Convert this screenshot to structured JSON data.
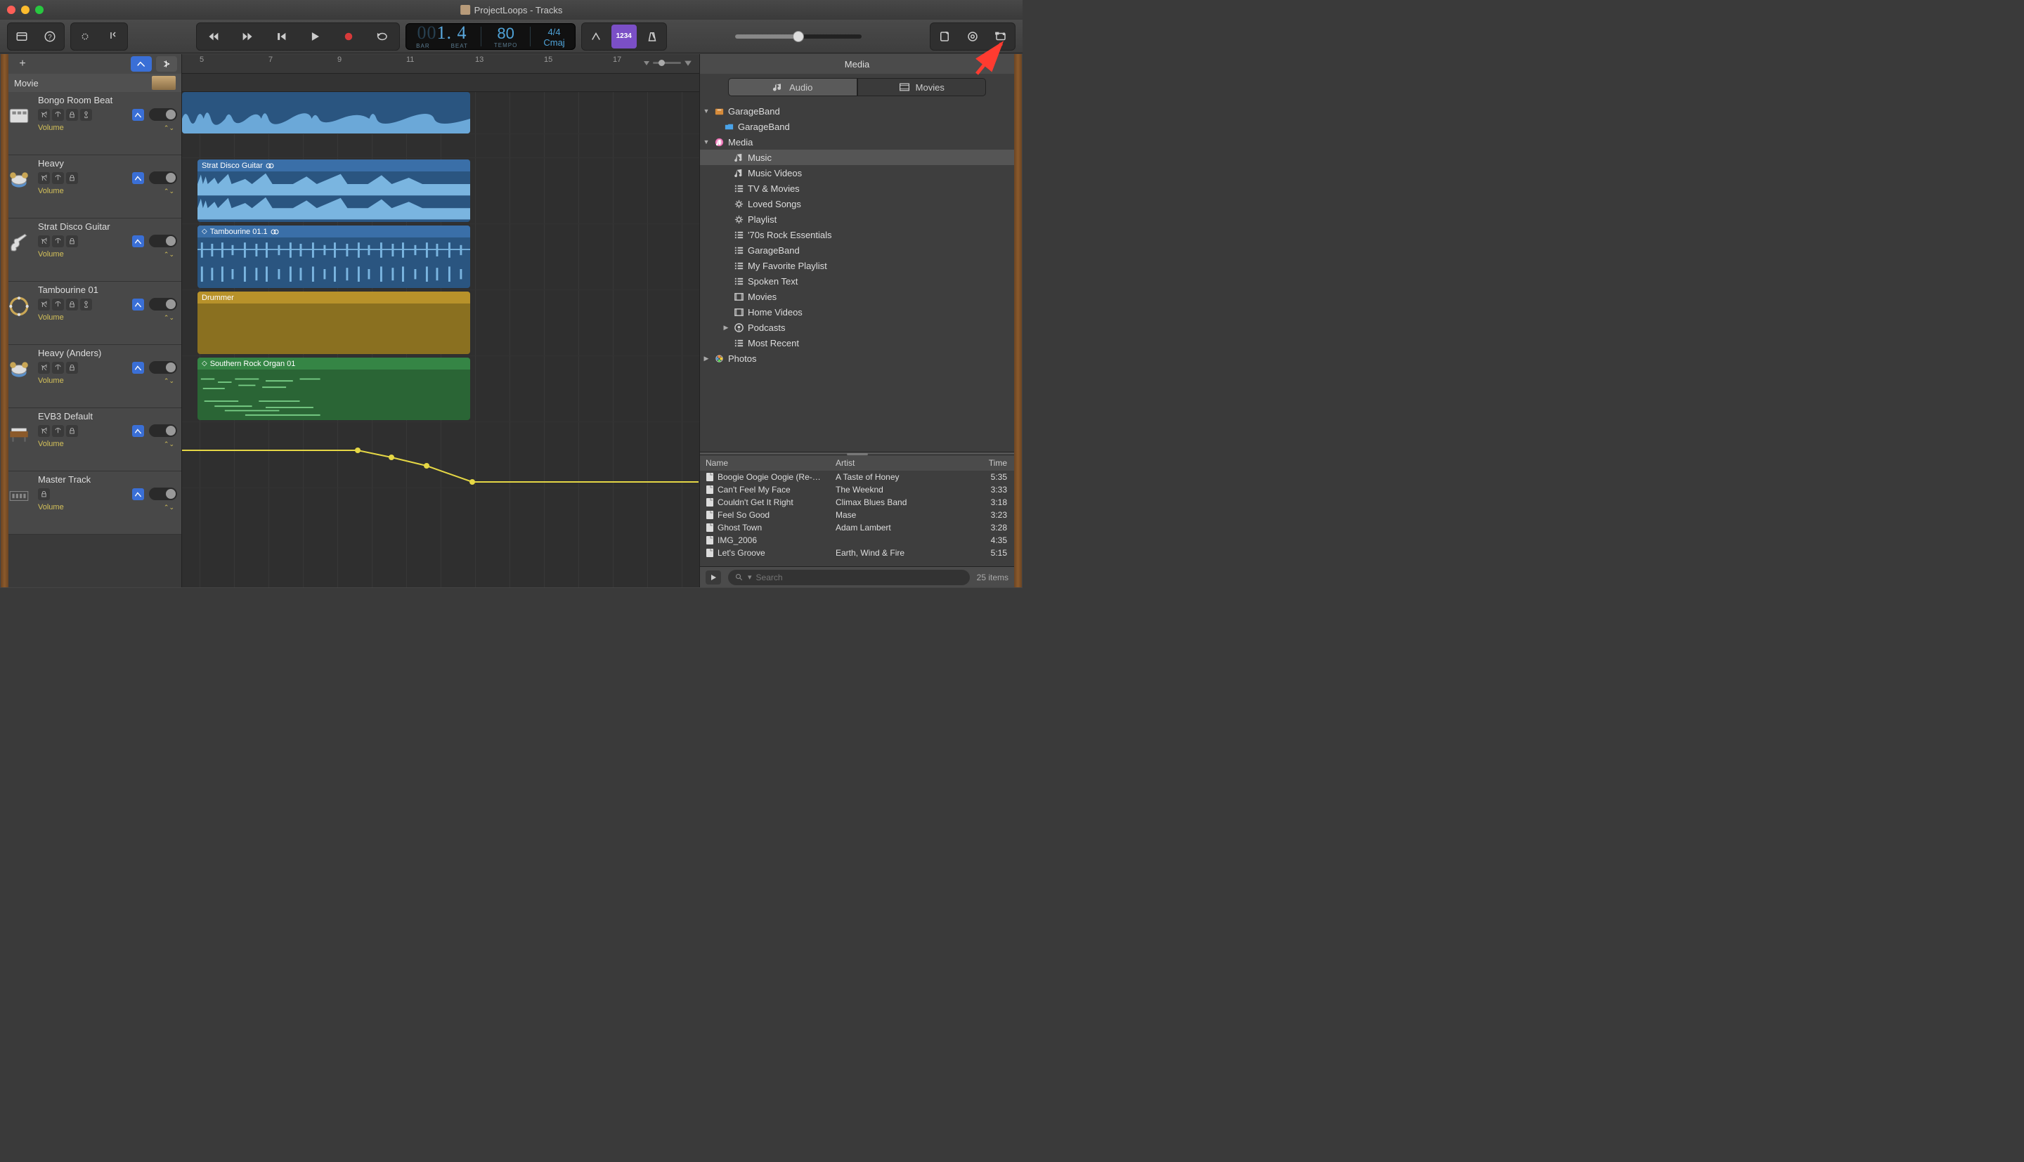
{
  "window": {
    "title": "ProjectLoops - Tracks"
  },
  "lcd": {
    "bars_dim": "00",
    "bars": "1",
    "beat": ". 4",
    "bar_label": "BAR",
    "beat_label": "BEAT",
    "tempo": "80",
    "tempo_label": "TEMPO",
    "sig": "4/4",
    "key": "Cmaj"
  },
  "toolbar": {
    "count_btn": "1234"
  },
  "ruler": {
    "marks": [
      "5",
      "7",
      "9",
      "11",
      "13",
      "15",
      "17"
    ]
  },
  "movie_label": "Movie",
  "tracks": [
    {
      "name": "Bongo Room Beat",
      "vol": "Volume",
      "icon": "drummachine"
    },
    {
      "name": "Heavy",
      "vol": "Volume",
      "icon": "drums"
    },
    {
      "name": "Strat Disco Guitar",
      "vol": "Volume",
      "icon": "guitar"
    },
    {
      "name": "Tambourine 01",
      "vol": "Volume",
      "icon": "tambourine"
    },
    {
      "name": "Heavy (Anders)",
      "vol": "Volume",
      "icon": "drums"
    },
    {
      "name": "EVB3 Default",
      "vol": "Volume",
      "icon": "organ"
    },
    {
      "name": "Master Track",
      "vol": "Volume",
      "icon": "master"
    }
  ],
  "regions": {
    "strat": "Strat Disco Guitar",
    "tamb": "Tambourine 01.1",
    "drummer": "Drummer",
    "organ": "Southern Rock Organ 01"
  },
  "browser": {
    "title": "Media",
    "tabs": {
      "audio": "Audio",
      "movies": "Movies"
    },
    "tree": [
      {
        "d": 0,
        "disc": "▼",
        "ico": "gb",
        "label": "GarageBand"
      },
      {
        "d": 1,
        "disc": "",
        "ico": "folder",
        "label": "GarageBand"
      },
      {
        "d": 0,
        "disc": "▼",
        "ico": "itunes",
        "label": "Media"
      },
      {
        "d": 2,
        "disc": "",
        "ico": "note",
        "label": "Music",
        "sel": true
      },
      {
        "d": 2,
        "disc": "",
        "ico": "note",
        "label": "Music Videos"
      },
      {
        "d": 2,
        "disc": "",
        "ico": "list",
        "label": "TV & Movies"
      },
      {
        "d": 2,
        "disc": "",
        "ico": "gear",
        "label": "Loved Songs"
      },
      {
        "d": 2,
        "disc": "",
        "ico": "gear",
        "label": "Playlist"
      },
      {
        "d": 2,
        "disc": "",
        "ico": "list",
        "label": "'70s Rock Essentials"
      },
      {
        "d": 2,
        "disc": "",
        "ico": "list",
        "label": "GarageBand"
      },
      {
        "d": 2,
        "disc": "",
        "ico": "list",
        "label": "My Favorite Playlist"
      },
      {
        "d": 2,
        "disc": "",
        "ico": "list",
        "label": "Spoken Text"
      },
      {
        "d": 2,
        "disc": "",
        "ico": "film",
        "label": "Movies"
      },
      {
        "d": 2,
        "disc": "",
        "ico": "film",
        "label": "Home Videos"
      },
      {
        "d": 2,
        "disc": "▶",
        "ico": "pod",
        "label": "Podcasts"
      },
      {
        "d": 2,
        "disc": "",
        "ico": "list",
        "label": "Most Recent"
      },
      {
        "d": 0,
        "disc": "▶",
        "ico": "photos",
        "label": "Photos"
      }
    ],
    "cols": {
      "name": "Name",
      "artist": "Artist",
      "time": "Time"
    },
    "songs": [
      {
        "name": "Boogie Oogie Oogie (Re-…",
        "artist": "A Taste of Honey",
        "time": "5:35"
      },
      {
        "name": "Can't Feel My Face",
        "artist": "The Weeknd",
        "time": "3:33"
      },
      {
        "name": "Couldn't Get It Right",
        "artist": "Climax Blues Band",
        "time": "3:18"
      },
      {
        "name": "Feel So Good",
        "artist": "Mase",
        "time": "3:23"
      },
      {
        "name": "Ghost Town",
        "artist": "Adam Lambert",
        "time": "3:28"
      },
      {
        "name": "IMG_2006",
        "artist": "",
        "time": "4:35"
      },
      {
        "name": "Let's Groove",
        "artist": "Earth, Wind & Fire",
        "time": "5:15"
      }
    ],
    "search_placeholder": "Search",
    "items": "25 items"
  }
}
